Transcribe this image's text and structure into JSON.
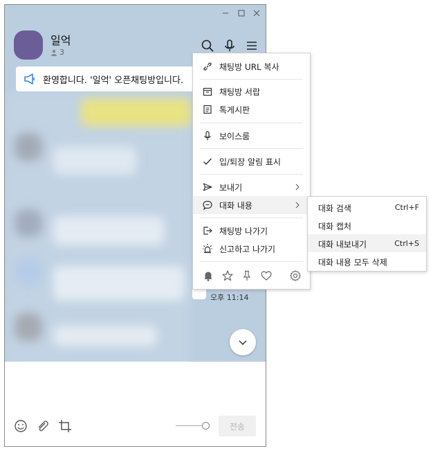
{
  "colors": {
    "chat_bg": "#bacee0",
    "avatar": "#6b5d98",
    "notice_icon": "#3c84e6"
  },
  "room": {
    "title": "일억",
    "member_count": "3"
  },
  "notice": {
    "text": "환영합니다. '일억' 오픈채팅방입니다."
  },
  "chat": {
    "time": "오후 11:14"
  },
  "menu": {
    "items": [
      {
        "label": "채팅방 URL 복사",
        "icon": "link-icon"
      },
      {
        "label": "채팅방 서랍",
        "icon": "drawer-icon"
      },
      {
        "label": "톡게시판",
        "icon": "board-icon"
      },
      {
        "label": "보이스룸",
        "icon": "microphone-icon"
      },
      {
        "label": "입/퇴장 알림 표시",
        "icon": "check-icon"
      },
      {
        "label": "보내기",
        "icon": "send-icon"
      },
      {
        "label": "대화 내용",
        "icon": "speech-bubble-icon"
      },
      {
        "label": "채팅방 나가기",
        "icon": "exit-icon"
      },
      {
        "label": "신고하고 나가기",
        "icon": "alarm-light-icon"
      }
    ]
  },
  "submenu": {
    "items": [
      {
        "label": "대화 검색",
        "shortcut": "Ctrl+F"
      },
      {
        "label": "대화 캡처",
        "shortcut": ""
      },
      {
        "label": "대화 내보내기",
        "shortcut": "Ctrl+S"
      },
      {
        "label": "대화 내용 모두 삭제",
        "shortcut": ""
      }
    ]
  },
  "composer": {
    "send_label": "전송"
  }
}
